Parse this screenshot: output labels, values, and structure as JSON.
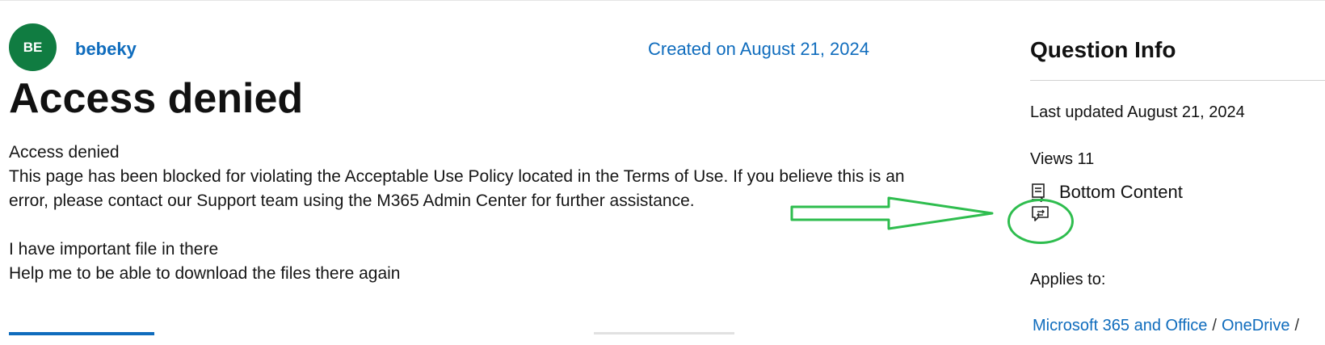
{
  "author": {
    "initials": "BE",
    "name": "bebeky"
  },
  "question": {
    "created": "Created on August 21, 2024",
    "title": "Access denied",
    "body": {
      "line1": "Access denied",
      "line2": "This page has been blocked for violating the Acceptable Use Policy located in the Terms of Use. If you believe this is an error, please contact our Support team using the M365 Admin Center for further assistance.",
      "line3": "I have important file in there",
      "line4": "Help me to be able to download the files there again"
    }
  },
  "question_info": {
    "title": "Question Info",
    "last_updated": "Last updated August 21, 2024",
    "views": "Views 11",
    "bottom_content": "Bottom Content",
    "applies_to": "Applies to:",
    "links": [
      "Microsoft 365 and Office",
      "OneDrive"
    ],
    "separator": "/"
  },
  "annotation": {
    "color": "#2ebd4e",
    "arrow_icon": "right-arrow-outline-icon",
    "circle_icon": "highlight-circle"
  },
  "colors": {
    "accent": "#0f6cbd",
    "avatar_bg": "#107c41"
  }
}
